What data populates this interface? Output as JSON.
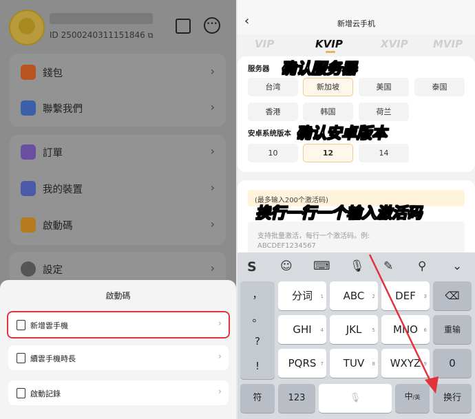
{
  "left": {
    "user_id": "ID 2500240311151846",
    "menu": [
      {
        "label": "錢包",
        "icon": "wallet-icon",
        "color": "#b8541e"
      },
      {
        "label": "聯繫我們",
        "icon": "chat-bubbles-icon",
        "color": "#3b5fa8"
      },
      {
        "label": "訂單",
        "icon": "order-icon",
        "color": "#6a4fa0"
      },
      {
        "label": "我的裝置",
        "icon": "device-icon",
        "color": "#4a5aa8"
      },
      {
        "label": "啟動碼",
        "icon": "activation-code-icon",
        "color": "#b87a1e"
      },
      {
        "label": "設定",
        "icon": "settings-icon",
        "color": "#444444"
      }
    ],
    "sheet": {
      "title": "啟動碼",
      "items": [
        "新增雲手機",
        "續雲手機時長",
        "啟動記錄"
      ]
    }
  },
  "right": {
    "title": "新增云手机",
    "tabs": [
      "VIP",
      "KVIP",
      "XVIP",
      "MVIP"
    ],
    "selected_tab": "KVIP",
    "server_label": "服务器",
    "servers": [
      "台湾",
      "新加坡",
      "美国",
      "泰国",
      "香港",
      "韩国",
      "荷兰"
    ],
    "selected_server": "新加坡",
    "android_label": "安卓系统版本",
    "android_versions": [
      "10",
      "12",
      "14"
    ],
    "selected_android": "12",
    "code_hint": "(最多输入200个激活码)",
    "code_placeholder_1": "支持批量激活，每行一个激活码。例:",
    "code_placeholder_2": "ABCDEF1234567",
    "overlay": {
      "confirm_server": "确认服务器",
      "confirm_android": "确认安卓版本",
      "enter_codes": "换行一行一个输入激活码"
    }
  },
  "keyboard": {
    "left_column": [
      "，",
      "。",
      "?",
      "!"
    ],
    "row1": [
      {
        "label": "分词",
        "num": "1"
      },
      {
        "label": "ABC",
        "num": "2"
      },
      {
        "label": "DEF",
        "num": "3"
      }
    ],
    "row2": [
      {
        "label": "GHI",
        "num": "4"
      },
      {
        "label": "JKL",
        "num": "5"
      },
      {
        "label": "MNO",
        "num": "6"
      }
    ],
    "row3": [
      {
        "label": "PQRS",
        "num": "7"
      },
      {
        "label": "TUV",
        "num": "8"
      },
      {
        "label": "WXYZ",
        "num": "9"
      }
    ],
    "right_column": [
      "⌫",
      "重输",
      "0"
    ],
    "bottom": {
      "symbols": "符",
      "numbers": "123",
      "lang": "中",
      "lang_sub": "/英",
      "enter": "换行"
    }
  },
  "colors": {
    "highlight_red": "#e0333a",
    "accent_orange": "#f0c98c",
    "arrow_red": "#e0333a"
  }
}
